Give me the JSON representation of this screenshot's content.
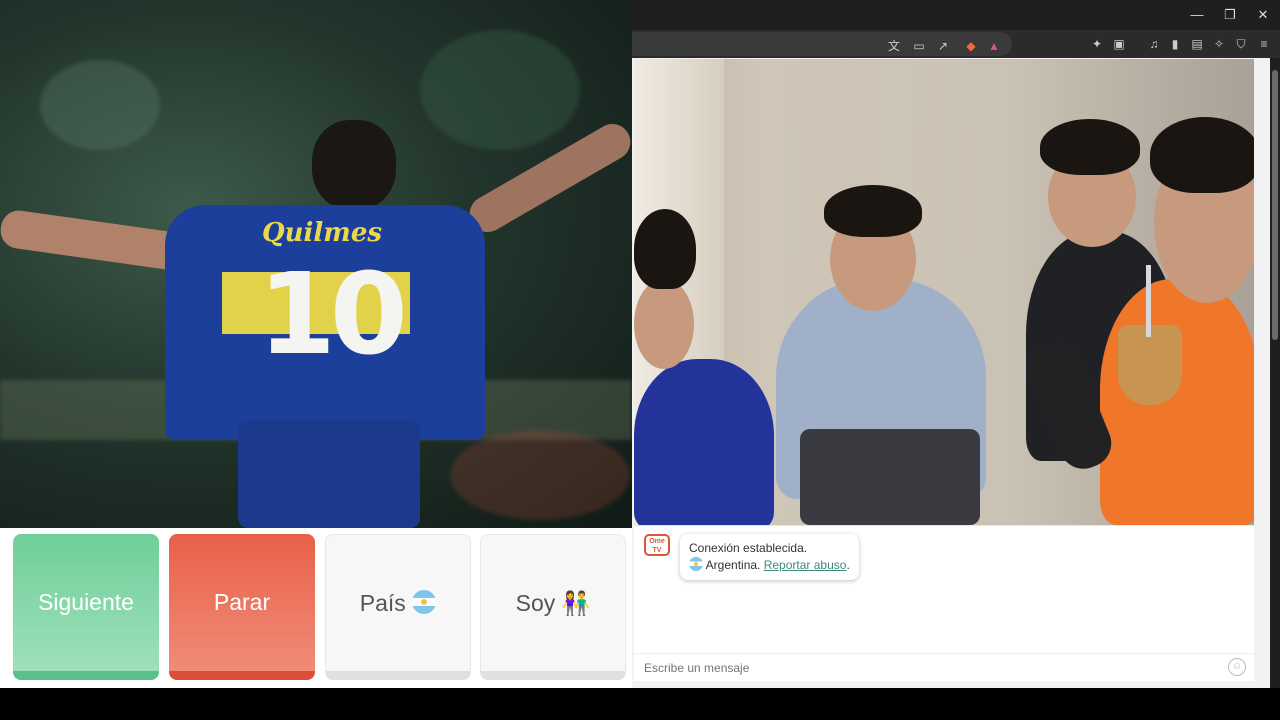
{
  "left_video": {
    "jersey_text": "Quilmes",
    "jersey_number": "10"
  },
  "window_controls": {
    "minimize": "—",
    "restore": "❐",
    "close": "✕"
  },
  "controls": {
    "next_label": "Siguiente",
    "stop_label": "Parar",
    "country_label": "País",
    "gender_label": "Soy",
    "gender_icon": "👫"
  },
  "chat": {
    "logo_text": "Ome TV",
    "status_message": "Conexión establecida.",
    "country": "Argentina.",
    "report_link": "Reportar abuso",
    "report_suffix": ".",
    "input_placeholder": "Escribe un mensaje"
  },
  "colors": {
    "next": "#6fcf9a",
    "stop": "#e8604a",
    "link": "#3a8b7a"
  }
}
